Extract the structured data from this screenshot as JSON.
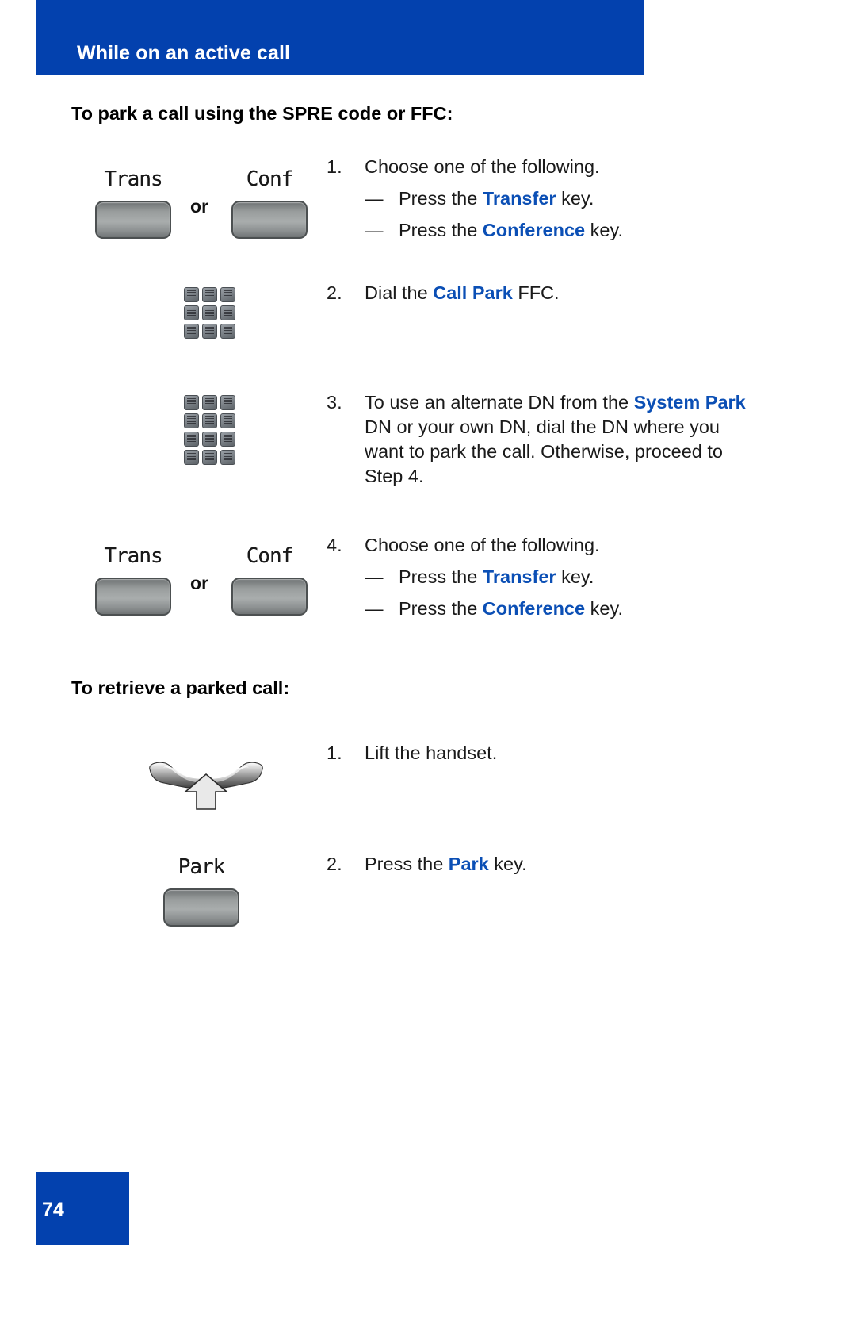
{
  "header": {
    "title": "While on an active call",
    "banner_color": "#0341ae"
  },
  "sections": [
    {
      "heading": "To park a call using the SPRE code or FFC:",
      "steps": [
        {
          "num": "1.",
          "text": "Choose one of the following.",
          "sub": [
            {
              "dash": "—",
              "pre": "Press the ",
              "hl": "Transfer",
              "post": " key."
            },
            {
              "dash": "—",
              "pre": "Press the ",
              "hl": "Conference",
              "post": " key."
            }
          ],
          "icon": "trans-or-conf",
          "icon_labels": {
            "left": "Trans",
            "or": "or",
            "right": "Conf"
          }
        },
        {
          "num": "2.",
          "pre": "Dial the ",
          "hl": "Call Park",
          "post": " FFC.",
          "icon": "keypad"
        },
        {
          "num": "3.",
          "lines": [
            {
              "pre": "To use an alternate DN from the ",
              "hl": "System",
              "post": ""
            },
            {
              "pre": "",
              "hl": "Park",
              "post": " DN or your own DN, dial the DN"
            },
            {
              "pre": "where you want to park the call.",
              "hl": "",
              "post": ""
            },
            {
              "pre": "Otherwise, proceed to Step 4.",
              "hl": "",
              "post": ""
            }
          ],
          "icon": "keypad"
        },
        {
          "num": "4.",
          "text": "Choose one of the following.",
          "sub": [
            {
              "dash": "—",
              "pre": "Press the ",
              "hl": "Transfer",
              "post": " key."
            },
            {
              "dash": "—",
              "pre": "Press the ",
              "hl": "Conference",
              "post": " key."
            }
          ],
          "icon": "trans-or-conf",
          "icon_labels": {
            "left": "Trans",
            "or": "or",
            "right": "Conf"
          }
        }
      ]
    },
    {
      "heading": "To retrieve a parked call:",
      "steps": [
        {
          "num": "1.",
          "text": "Lift the handset.",
          "icon": "handset-lift"
        },
        {
          "num": "2.",
          "pre": "Press the ",
          "hl": "Park",
          "post": " key.",
          "icon": "park-key",
          "icon_labels": {
            "left": "Park"
          }
        }
      ]
    }
  ],
  "footer": {
    "page_number": "74"
  },
  "colors": {
    "brand_blue": "#0341ae",
    "highlight_blue": "#0b4fb5",
    "body_text": "#1a1a1a"
  }
}
